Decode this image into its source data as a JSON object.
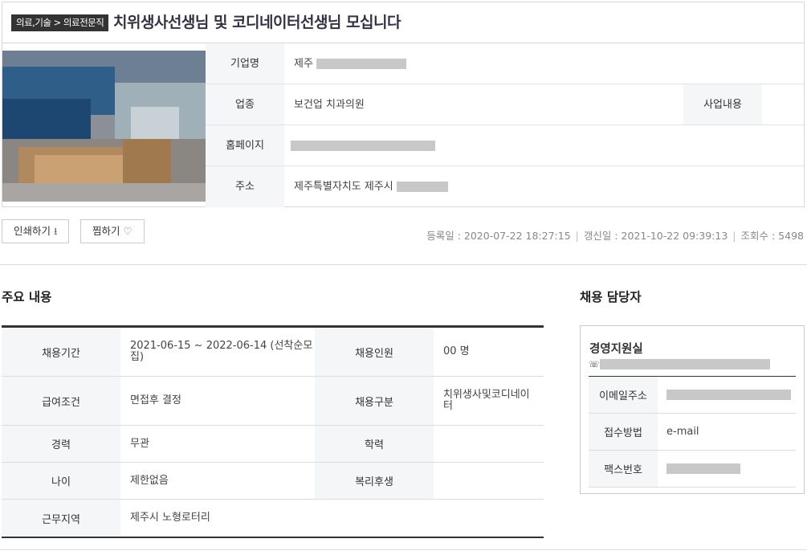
{
  "header": {
    "category": "의료,기술 > 의료전문직",
    "title": "치위생사선생님 및 코디네이터선생님 모십니다"
  },
  "company": {
    "name_label": "기업명",
    "name_value": "제주",
    "industry_label": "업종",
    "industry_value": "보건업 치과의원",
    "business_label": "사업내용",
    "homepage_label": "홈페이지",
    "address_label": "주소",
    "address_value": "제주특별자치도 제주시"
  },
  "actions": {
    "print_label": "인쇄하기",
    "favorite_label": "찜하기"
  },
  "meta": {
    "registered": "등록일 : 2020-07-22 18:27:15",
    "updated": "갱신일 : 2021-10-22 09:39:13",
    "views": "조회수 : 5498",
    "separator": "|"
  },
  "main": {
    "section_title": "주요 내용",
    "rows": [
      {
        "k1": "채용기간",
        "v1": "2021-06-15 ~ 2022-06-14 (선착순모집)",
        "k2": "채용인원",
        "v2": "00 명"
      },
      {
        "k1": "급여조건",
        "v1": "면접후 결정",
        "k2": "채용구분",
        "v2": "치위생사및코디네이터"
      },
      {
        "k1": "경력",
        "v1": "무관",
        "k2": "학력",
        "v2": ""
      },
      {
        "k1": "나이",
        "v1": "제한없음",
        "k2": "복리후생",
        "v2": ""
      },
      {
        "k1": "근무지역",
        "v1": "제주시 노형로터리",
        "k2": "",
        "v2": ""
      }
    ]
  },
  "contact": {
    "section_title": "채용 담당자",
    "department": "경영지원실",
    "phone_icon": "☏",
    "email_label": "이메일주소",
    "method_label": "접수방법",
    "method_value": "e-mail",
    "fax_label": "팩스번호"
  },
  "icons": {
    "print": "download-tray-icon",
    "favorite": "heart-icon",
    "phone": "phone-icon"
  },
  "colors": {
    "badge_bg": "#333333",
    "title": "#333344",
    "label_bg": "#f5f6f8",
    "heart": "#e05252"
  }
}
